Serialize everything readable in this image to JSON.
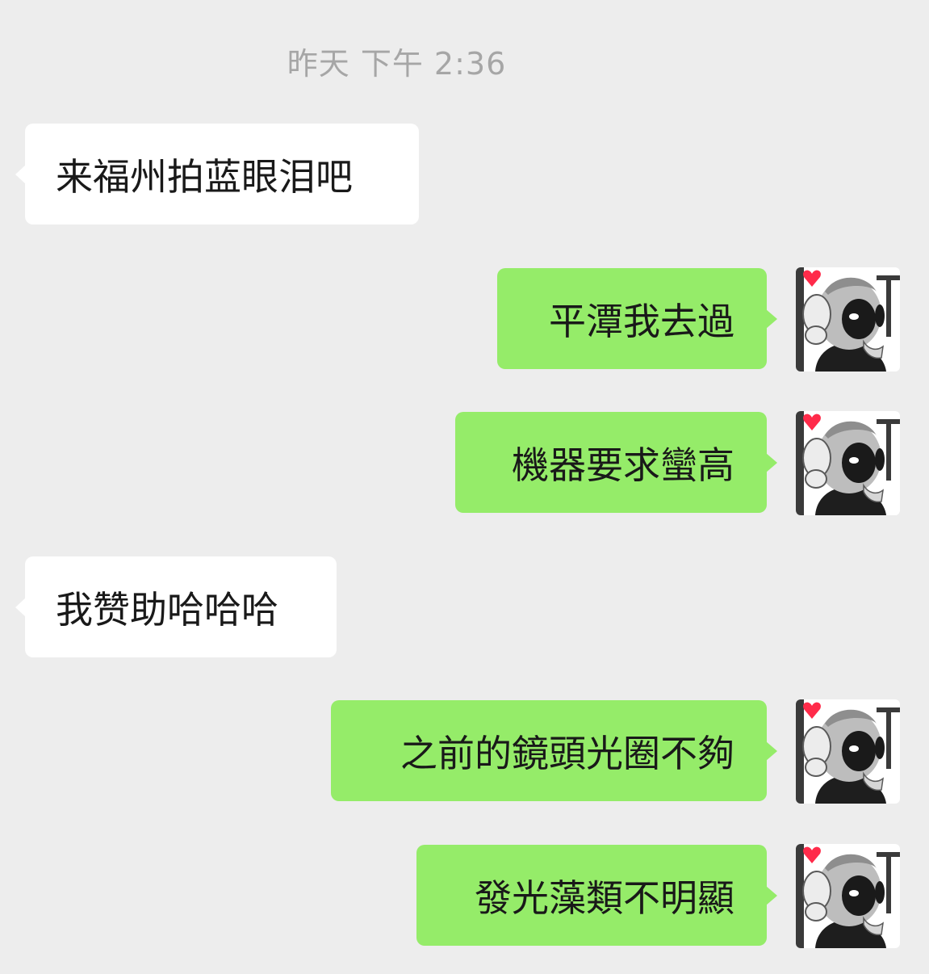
{
  "timestamp": "昨天 下午 2:36",
  "messages": [
    {
      "direction": "incoming",
      "text": "来福州拍蓝眼泪吧"
    },
    {
      "direction": "outgoing",
      "text": "平潭我去過",
      "avatar_icon": "cartoon-character-avatar-icon"
    },
    {
      "direction": "outgoing",
      "text": "機器要求蠻高",
      "avatar_icon": "cartoon-character-avatar-icon"
    },
    {
      "direction": "incoming",
      "text": "我赞助哈哈哈"
    },
    {
      "direction": "outgoing",
      "text": "之前的鏡頭光圈不夠",
      "avatar_icon": "cartoon-character-avatar-icon"
    },
    {
      "direction": "outgoing",
      "text": "發光藻類不明顯",
      "avatar_icon": "cartoon-character-avatar-icon"
    }
  ],
  "colors": {
    "background": "#ededed",
    "incoming_bubble": "#ffffff",
    "outgoing_bubble": "#95ec69",
    "timestamp_text": "#a6a6a6",
    "message_text": "#191919",
    "heart": "#ff2b4a"
  }
}
